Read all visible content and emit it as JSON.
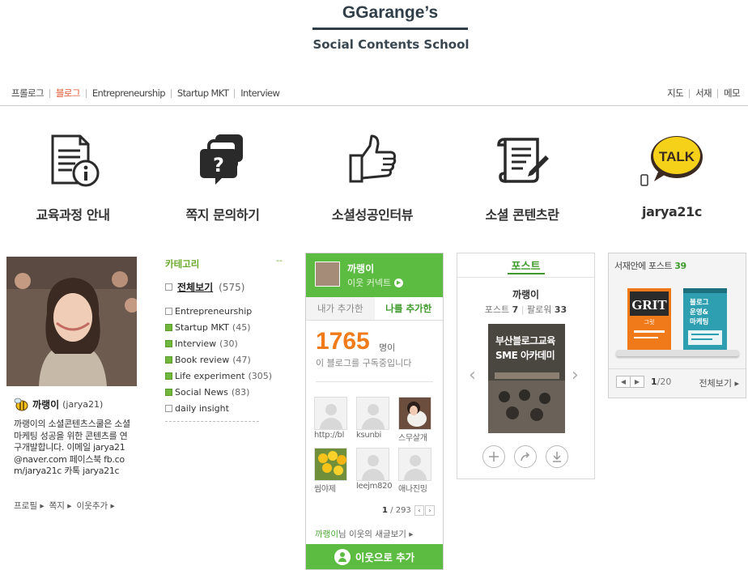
{
  "header": {
    "brand_title": "GGarange’s",
    "brand_subtitle": "Social Contents School"
  },
  "nav": {
    "left": [
      "프롤로그",
      "블로그",
      "Entrepreneurship",
      "Startup MKT",
      "Interview"
    ],
    "active": "블로그",
    "right": [
      "지도",
      "서재",
      "메모"
    ]
  },
  "shortcuts": [
    {
      "label": "교육과정 안내",
      "icon": "document-info-icon"
    },
    {
      "label": "쪽지 문의하기",
      "icon": "message-question-icon"
    },
    {
      "label": "소셜성공인터뷰",
      "icon": "thumbs-up-icon"
    },
    {
      "label": "소셜 콘텐츠란",
      "icon": "scroll-pen-icon"
    },
    {
      "label": "jarya21c",
      "icon": "kakao-talk-icon"
    }
  ],
  "profile": {
    "nickname": "까랭이",
    "id": "(jarya21)",
    "description": "까랭이의 소셜콘텐츠스쿨은 소셜마케팅 성공을 위한 콘텐츠를 연구개발합니다. 이메일 jarya21@naver.com 페이스북 fb.com/jarya21c 카톡 jarya21c",
    "links": [
      "프로필 ▸",
      "쪽지 ▸",
      "이웃추가 ▸"
    ]
  },
  "categories": {
    "title": "카테고리",
    "toggle": "--",
    "all_label": "전체보기",
    "all_count": "(575)",
    "items": [
      {
        "name": "Entrepreneurship",
        "count": "",
        "icon": "page-icon"
      },
      {
        "name": "Startup MKT",
        "count": "(45)",
        "icon": "green-page-icon"
      },
      {
        "name": "Interview",
        "count": "(30)",
        "icon": "green-page-icon"
      },
      {
        "name": "Book review",
        "count": "(47)",
        "icon": "green-page-icon"
      },
      {
        "name": "Life experiment",
        "count": "(305)",
        "icon": "green-page-icon"
      },
      {
        "name": "Social News",
        "count": "(83)",
        "icon": "green-page-icon"
      },
      {
        "name": "daily insight",
        "count": "",
        "icon": "page-icon"
      }
    ]
  },
  "neighbors": {
    "name": "까랭이",
    "connect_label": "이웃 커넥트",
    "tabs": [
      "내가 추가한",
      "나를 추가한"
    ],
    "active_tab": "나를 추가한",
    "count": "1765",
    "count_unit": "명이",
    "count_desc": "이 블로그를 구독중입니다",
    "people": [
      {
        "caption": "http://bl",
        "type": "default"
      },
      {
        "caption": "ksunbi",
        "type": "default"
      },
      {
        "caption": "스무살개",
        "type": "photo-dog"
      },
      {
        "caption": "씸야제",
        "type": "photo-flowers"
      },
      {
        "caption": "leejm820",
        "type": "default"
      },
      {
        "caption": "애나진밍",
        "type": "default"
      }
    ],
    "page_current": "1",
    "page_total": "/ 293",
    "more_name": "까랭이",
    "more_text": "님 이웃의 새글보기 ▸",
    "add_button": "이웃으로 추가"
  },
  "posts": {
    "title": "포스트",
    "nickname": "까랭이",
    "posts_label": "포스트",
    "posts_count": "7",
    "followers_label": "팔로워",
    "followers_count": "33",
    "image_text": "부산블로그교육SME 아카데미",
    "actions": [
      "plus-icon",
      "share-icon",
      "download-icon"
    ]
  },
  "library": {
    "title": "서재안에 포스트",
    "count": "39",
    "books": [
      {
        "title": "GRIT",
        "subtitle": "그릿",
        "color": "#f07a1a"
      },
      {
        "title": "블로그 운영&마케팅",
        "color": "#2e9fb0"
      }
    ],
    "page_current": "1",
    "page_total": "/20",
    "see_all": "전체보기 ▸"
  }
}
